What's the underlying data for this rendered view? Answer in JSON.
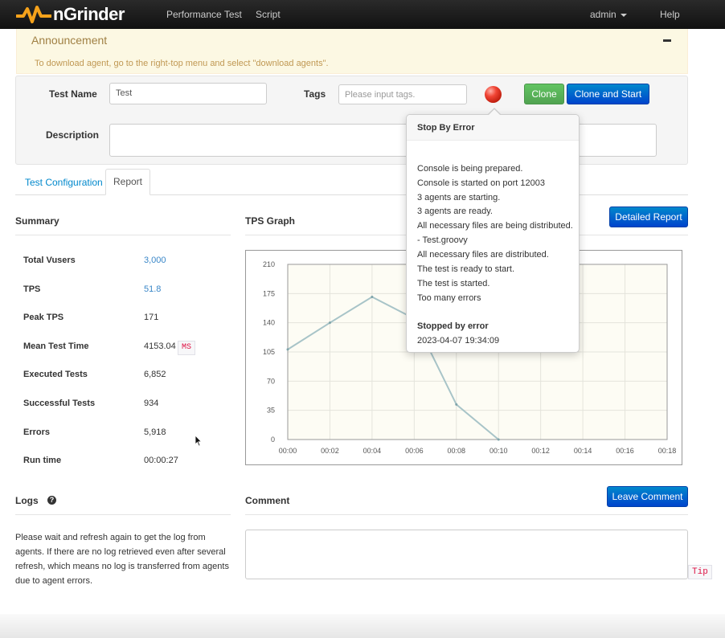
{
  "nav": {
    "brand": "nGrinder",
    "links": [
      "Performance Test",
      "Script"
    ],
    "user": "admin",
    "help": "Help"
  },
  "announcement": {
    "title": "Announcement",
    "text": "To download agent, go to the right-top menu and select \"download agents\"."
  },
  "form": {
    "test_name_label": "Test Name",
    "test_name_value": "Test",
    "tags_label": "Tags",
    "tags_placeholder": "Please input tags.",
    "description_label": "Description",
    "clone_label": "Clone",
    "clone_start_label": "Clone and Start"
  },
  "tabs": [
    "Test Configuration",
    "Report"
  ],
  "summary": {
    "title": "Summary",
    "rows": [
      {
        "label": "Total Vusers",
        "value": "3,000"
      },
      {
        "label": "TPS",
        "value": "51.8"
      },
      {
        "label": "Peak TPS",
        "value": "171"
      },
      {
        "label": "Mean Test Time",
        "value": "4153.04",
        "unit": "MS"
      },
      {
        "label": "Executed Tests",
        "value": "6,852"
      },
      {
        "label": "Successful Tests",
        "value": "934"
      },
      {
        "label": "Errors",
        "value": "5,918"
      },
      {
        "label": "Run time",
        "value": "00:00:27"
      }
    ]
  },
  "tps_graph": {
    "title": "TPS Graph",
    "detailed_report_label": "Detailed Report"
  },
  "chart_data": {
    "type": "line",
    "x": [
      "00:00",
      "00:02",
      "00:04",
      "00:06",
      "00:08",
      "00:10"
    ],
    "x_ticks": [
      "00:00",
      "00:02",
      "00:04",
      "00:06",
      "00:08",
      "00:10",
      "00:12",
      "00:14",
      "00:16",
      "00:18"
    ],
    "y": [
      108,
      140,
      171,
      145,
      42,
      0
    ],
    "y_ticks": [
      0,
      35,
      70,
      105,
      140,
      175,
      210
    ],
    "ylim": [
      0,
      210
    ],
    "xlim_index": [
      0,
      9
    ],
    "grid": true,
    "line_color": "#a8c4c8",
    "plot_bg": "#fdfcf4"
  },
  "popover": {
    "title": "Stop By Error",
    "lines": [
      "Console is being prepared.",
      "Console is started on port 12003",
      "3 agents are starting.",
      "3 agents are ready.",
      "All necessary files are being distributed.",
      "- Test.groovy",
      "All necessary files are distributed.",
      "The test is ready to start.",
      "The test is started.",
      "Too many errors"
    ],
    "final_title": "Stopped by error",
    "final_time": "2023-04-07 19:34:09"
  },
  "logs": {
    "title": "Logs",
    "help_icon": "?",
    "text": "Please wait and refresh again to get the log from agents. If there are no log retrieved even after several refresh, which means no log is transferred from agents due to agent errors."
  },
  "comment": {
    "title": "Comment",
    "leave_comment_label": "Leave Comment",
    "tip": "Tip"
  }
}
